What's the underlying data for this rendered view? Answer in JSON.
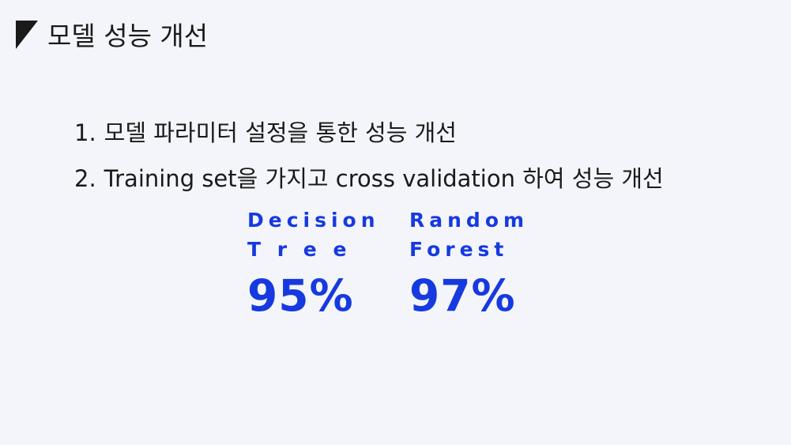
{
  "page": {
    "title": "모델 성능 개선",
    "title_mark_icon": "corner-triangle-icon"
  },
  "points": [
    {
      "number": "1.",
      "text": "모델 파라미터 설정을 통한 성능 개선"
    },
    {
      "number": "2.",
      "text": "Training set을 가지고 cross validation 하여 성능 개선"
    }
  ],
  "metrics": [
    {
      "name_line1": "Decision",
      "name_line2": "T r e e",
      "value": "95%"
    },
    {
      "name_line1": "Random",
      "name_line2": "Forest",
      "value": "97%"
    }
  ],
  "colors": {
    "accent": "#1639e0",
    "text": "#1a1a1a",
    "background": "#f3f5fa"
  }
}
